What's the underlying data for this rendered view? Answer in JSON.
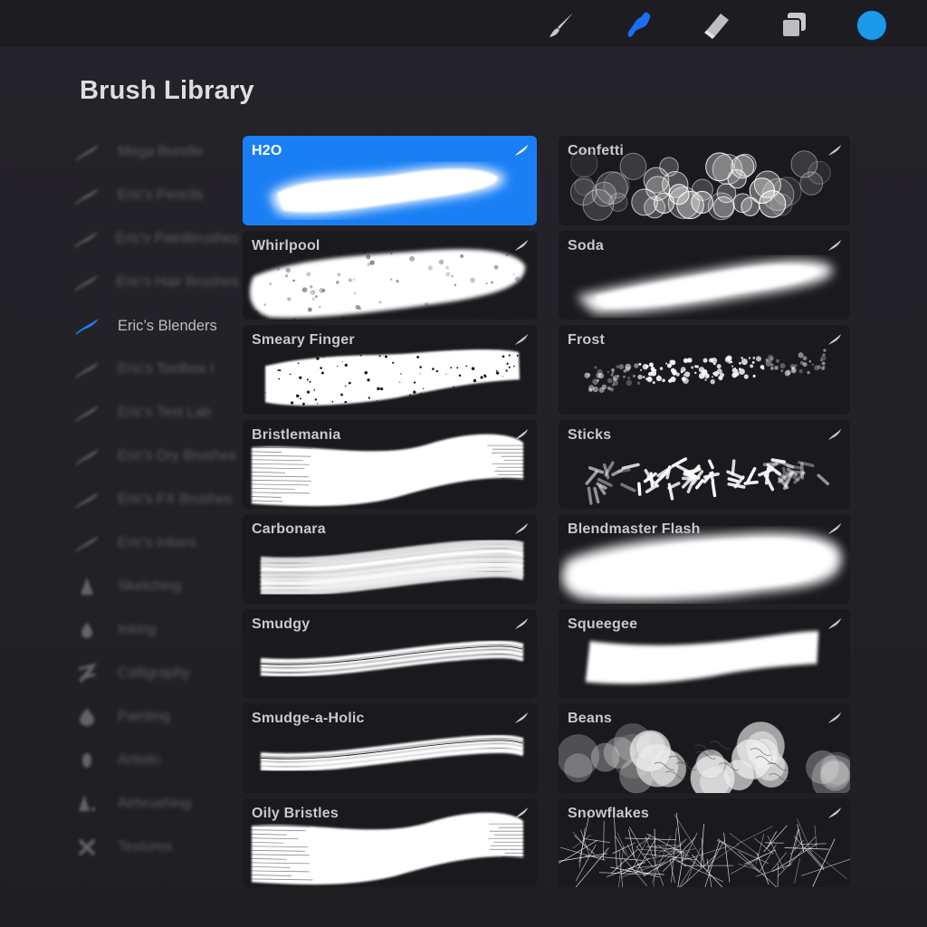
{
  "toolbar": {
    "tools": [
      {
        "name": "paintbrush-icon",
        "label": "Paint",
        "active": false
      },
      {
        "name": "smudge-finger-icon",
        "label": "Smudge",
        "active": true
      },
      {
        "name": "eraser-icon",
        "label": "Erase",
        "active": false
      },
      {
        "name": "layers-icon",
        "label": "Layers",
        "active": false
      },
      {
        "name": "color-swatch",
        "label": "Colors",
        "active": false
      }
    ],
    "current_color": "#1a9ae8",
    "accent_color": "#1a7ff5"
  },
  "header": {
    "title": "Brush Library"
  },
  "sidebar": {
    "items": [
      {
        "label": "Mega Bundle",
        "icon": "brush-stroke-icon",
        "active": false
      },
      {
        "label": "Eric's Pencils",
        "icon": "brush-stroke-icon",
        "active": false
      },
      {
        "label": "Eric's Paintbrushes",
        "icon": "brush-stroke-icon",
        "active": false
      },
      {
        "label": "Eric's Hair Brushes",
        "icon": "brush-stroke-icon",
        "active": false
      },
      {
        "label": "Eric’s Blenders",
        "icon": "brush-stroke-icon",
        "active": true
      },
      {
        "label": "Eric's Toolbox I",
        "icon": "brush-stroke-icon",
        "active": false
      },
      {
        "label": "Eric's Test Lab",
        "icon": "brush-stroke-icon",
        "active": false
      },
      {
        "label": "Eric's Dry Brushes",
        "icon": "brush-stroke-icon",
        "active": false
      },
      {
        "label": "Eric's FX Brushes",
        "icon": "brush-stroke-icon",
        "active": false
      },
      {
        "label": "Eric's Inkers",
        "icon": "brush-stroke-icon",
        "active": false
      },
      {
        "label": "Sketching",
        "icon": "pencil-tip-icon",
        "active": false
      },
      {
        "label": "Inking",
        "icon": "ink-drop-icon",
        "active": false
      },
      {
        "label": "Calligraphy",
        "icon": "calligraphy-icon",
        "active": false
      },
      {
        "label": "Painting",
        "icon": "paint-drop-icon",
        "active": false
      },
      {
        "label": "Artistic",
        "icon": "artistic-icon",
        "active": false
      },
      {
        "label": "Airbrushing",
        "icon": "airbrush-icon",
        "active": false
      },
      {
        "label": "Textures",
        "icon": "textures-icon",
        "active": false
      }
    ]
  },
  "brushes": [
    {
      "name": "H2O",
      "style": "soft-blob",
      "selected": true
    },
    {
      "name": "Confetti",
      "style": "bokeh",
      "selected": false
    },
    {
      "name": "Whirlpool",
      "style": "rough-blob",
      "selected": false
    },
    {
      "name": "Soda",
      "style": "soft-cloud",
      "selected": false
    },
    {
      "name": "Smeary Finger",
      "style": "speckled",
      "selected": false
    },
    {
      "name": "Frost",
      "style": "dots",
      "selected": false
    },
    {
      "name": "Bristlemania",
      "style": "wide-bristle",
      "selected": false
    },
    {
      "name": "Sticks",
      "style": "sticks",
      "selected": false
    },
    {
      "name": "Carbonara",
      "style": "streaks",
      "selected": false
    },
    {
      "name": "Blendmaster Flash",
      "style": "big-soft",
      "selected": false
    },
    {
      "name": "Smudgy",
      "style": "thin-streaks",
      "selected": false
    },
    {
      "name": "Squeegee",
      "style": "flat-band",
      "selected": false
    },
    {
      "name": "Smudge-a-Holic",
      "style": "thin-streaks-2",
      "selected": false
    },
    {
      "name": "Beans",
      "style": "circles",
      "selected": false
    },
    {
      "name": "Oily Bristles",
      "style": "wide-bristle-2",
      "selected": false
    },
    {
      "name": "Snowflakes",
      "style": "lines",
      "selected": false
    }
  ]
}
